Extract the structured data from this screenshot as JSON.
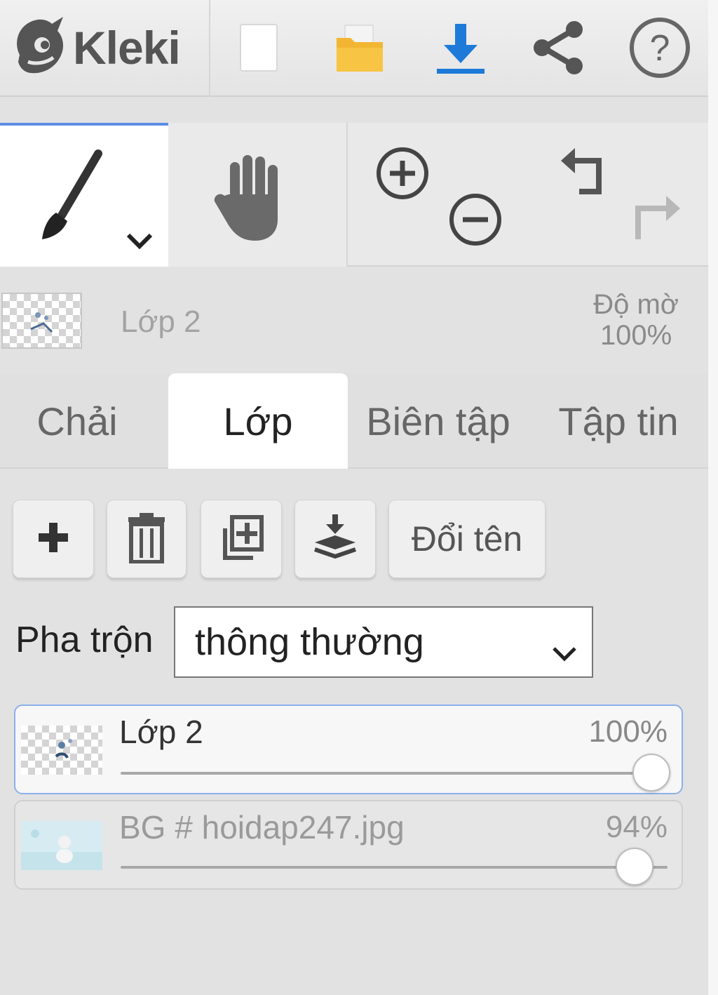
{
  "app": {
    "name": "Kleki"
  },
  "toolbar": {
    "icons": [
      "kleki-logo-icon",
      "new-image-icon",
      "open-folder-icon",
      "download-icon",
      "share-icon",
      "help-icon"
    ],
    "colors": {
      "folder": "#f2b632",
      "download": "#1e7ad8"
    }
  },
  "tools": {
    "icons": [
      "brush-icon",
      "hand-icon",
      "zoom-in-icon",
      "zoom-out-icon",
      "undo-icon",
      "redo-icon"
    ],
    "active_accent": "#5b8ee6"
  },
  "current_layer": {
    "name": "Lớp 2",
    "opacity_label": "Độ mờ",
    "opacity_value": "100%"
  },
  "tabs": [
    {
      "label": "Chải",
      "active": false
    },
    {
      "label": "Lớp",
      "active": true
    },
    {
      "label": "Biên tập",
      "active": false
    },
    {
      "label": "Tập tin",
      "active": false
    }
  ],
  "layer_actions": {
    "icons": [
      "add-layer-icon",
      "delete-layer-icon",
      "duplicate-layer-icon",
      "merge-down-icon"
    ],
    "rename_label": "Đổi tên"
  },
  "blend": {
    "label": "Pha trộn",
    "selected": "thông thường"
  },
  "layers": [
    {
      "name": "Lớp 2",
      "opacity_text": "100%",
      "opacity": 1.0,
      "active": true
    },
    {
      "name": "BG # hoidap247.jpg",
      "opacity_text": "94%",
      "opacity": 0.94,
      "active": false
    }
  ]
}
